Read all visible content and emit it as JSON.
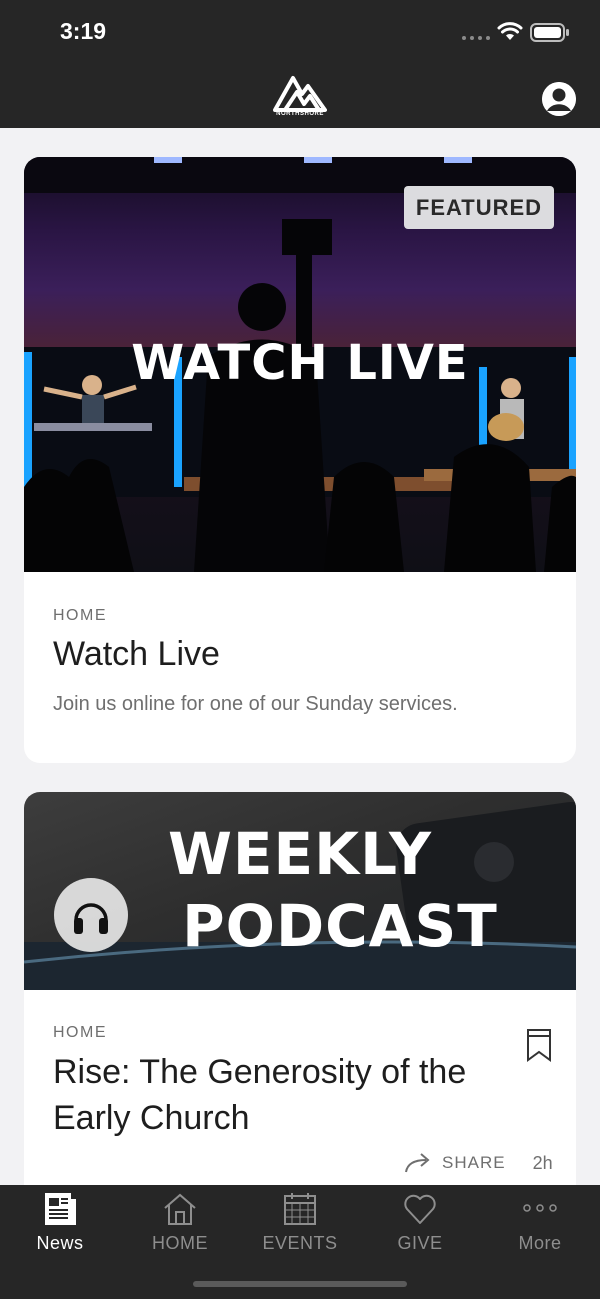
{
  "status_bar": {
    "time": "3:19"
  },
  "header": {
    "logo_text": "NORTHSHORE",
    "logo_icon": "mountain-logo",
    "profile_icon": "user-icon"
  },
  "cards": [
    {
      "image_title": "WATCH LIVE",
      "badge": "FEATURED",
      "eyebrow": "HOME",
      "title": "Watch Live",
      "description": "Join us online for one of our Sunday services."
    },
    {
      "image_title_line1": "WEEKLY",
      "image_title_line2": "PODCAST",
      "media_icon": "headphones-icon",
      "eyebrow": "HOME",
      "title_line1": "Rise: The Generosity of the",
      "title_line2": "Early Church",
      "share_label": "SHARE",
      "age": "2h"
    }
  ],
  "tabbar": {
    "tabs": [
      {
        "label": "News",
        "icon": "newspaper-icon",
        "active": true
      },
      {
        "label": "HOME",
        "icon": "house-icon",
        "active": false
      },
      {
        "label": "EVENTS",
        "icon": "calendar-icon",
        "active": false
      },
      {
        "label": "GIVE",
        "icon": "heart-icon",
        "active": false
      },
      {
        "label": "More",
        "icon": "more-dots-icon",
        "active": false
      }
    ]
  }
}
